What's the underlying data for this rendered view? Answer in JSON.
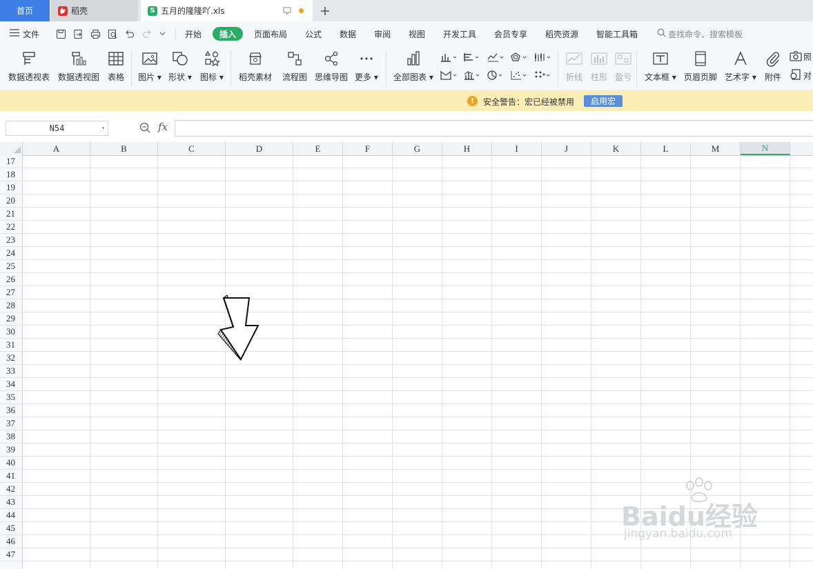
{
  "tabs": {
    "home": "首页",
    "daoke": "稻壳",
    "file": "五月的隆隆吖.xls"
  },
  "menu": {
    "file": "文件",
    "items": [
      "开始",
      "插入",
      "页面布局",
      "公式",
      "数据",
      "审阅",
      "视图",
      "开发工具",
      "会员专享",
      "稻壳资源",
      "智能工具箱"
    ],
    "active": "插入",
    "search_placeholder": "查找命令、搜索模板"
  },
  "ribbon": {
    "pivot_table": "数据透视表",
    "pivot_chart": "数据透视图",
    "table": "表格",
    "picture": "图片",
    "shape": "形状",
    "icon": "图标",
    "daoke_material": "稻壳素材",
    "flowchart": "流程图",
    "mindmap": "思维导图",
    "more": "更多",
    "all_charts": "全部图表",
    "sparkline_line": "折线",
    "sparkline_col": "柱形",
    "sparkline_winloss": "盈亏",
    "textbox": "文本框",
    "header_footer": "页眉页脚",
    "wordart": "艺术字",
    "attachment": "附件",
    "photo": "照",
    "object": "对"
  },
  "warning": {
    "text": "安全警告：宏已经被禁用",
    "button": "启用宏"
  },
  "formula_bar": {
    "name_box": "N54",
    "fx": "fx",
    "value": ""
  },
  "sheet": {
    "columns": [
      "A",
      "B",
      "C",
      "D",
      "E",
      "F",
      "G",
      "H",
      "I",
      "J",
      "K",
      "L",
      "M",
      "N"
    ],
    "selected_column": "N",
    "rows": [
      "17",
      "18",
      "19",
      "20",
      "21",
      "22",
      "23",
      "24",
      "25",
      "26",
      "27",
      "28",
      "29",
      "30",
      "31",
      "32",
      "33",
      "34",
      "35",
      "36",
      "37",
      "38",
      "39",
      "40",
      "41",
      "42",
      "43",
      "44",
      "45",
      "46",
      "47"
    ]
  },
  "watermark": {
    "big": "Baidu经验",
    "small": "jingyan.baidu.com"
  },
  "colors": {
    "accent_green": "#2aae67",
    "home_tab_blue": "#3d7fe6",
    "warning_bg": "#fdeeb8",
    "macro_button": "#5a8fd8"
  }
}
